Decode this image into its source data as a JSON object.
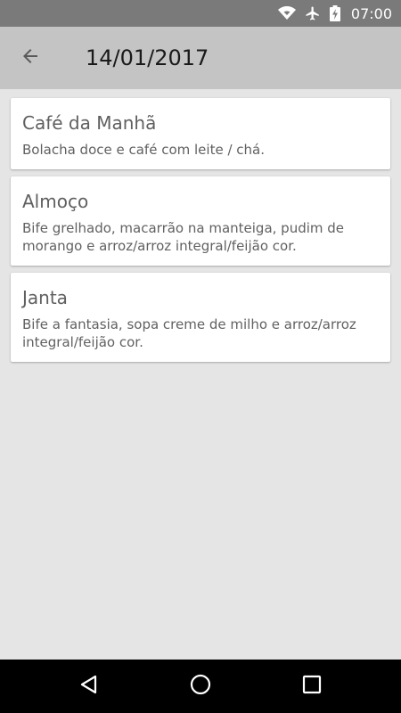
{
  "status_bar": {
    "time": "07:00",
    "icons": [
      "wifi-icon",
      "airplane-icon",
      "battery-charging-icon"
    ]
  },
  "app_bar": {
    "back_icon": "arrow-back-icon",
    "title": "14/01/2017"
  },
  "meals": [
    {
      "title": "Café da Manhã",
      "description": "Bolacha doce e café com leite / chá."
    },
    {
      "title": "Almoço",
      "description": "Bife grelhado, macarrão na manteiga, pudim de morango e arroz/arroz integral/feijão cor."
    },
    {
      "title": "Janta",
      "description": "Bife a fantasia, sopa creme de milho e arroz/arroz integral/feijão cor."
    }
  ],
  "nav_bar": {
    "icons": [
      "nav-back-icon",
      "nav-home-icon",
      "nav-recents-icon"
    ]
  },
  "colors": {
    "status_bar": "#7a7a7a",
    "app_bar": "#c4c4c4",
    "background": "#e5e5e5",
    "card": "#ffffff",
    "nav_bar": "#000000"
  }
}
